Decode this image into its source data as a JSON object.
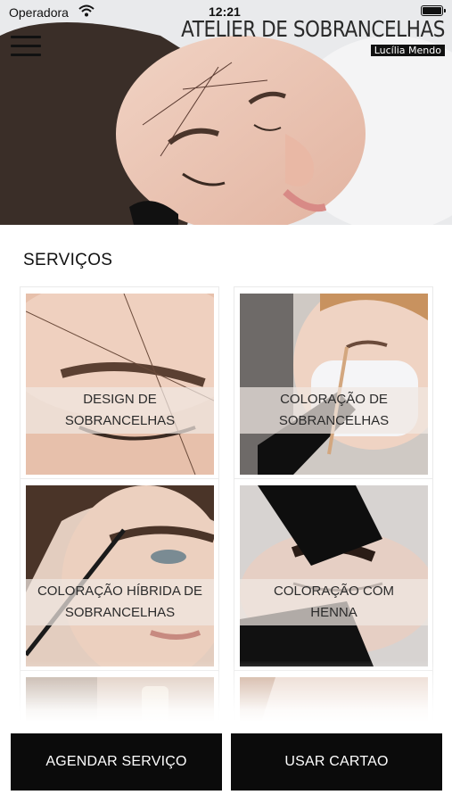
{
  "status_bar": {
    "carrier": "Operadora",
    "time": "12:21"
  },
  "header": {
    "title": "ATELIER DE SOBRANCELHAS",
    "subtitle": "Lucília Mendo",
    "menu_icon": "hamburger-icon"
  },
  "services": {
    "title": "SERVIÇOS",
    "items": [
      {
        "line1": "DESIGN DE",
        "line2": "SOBRANCELHAS"
      },
      {
        "line1": "COLORAÇÃO DE",
        "line2": "SOBRANCELHAS"
      },
      {
        "line1": "COLORAÇÃO HÍBRIDA DE",
        "line2": "SOBRANCELHAS"
      },
      {
        "line1": "COLORAÇÃO COM",
        "line2": "HENNA"
      }
    ]
  },
  "actions": {
    "book_label": "AGENDAR SERVIÇO",
    "card_label": "USAR CARTAO"
  }
}
